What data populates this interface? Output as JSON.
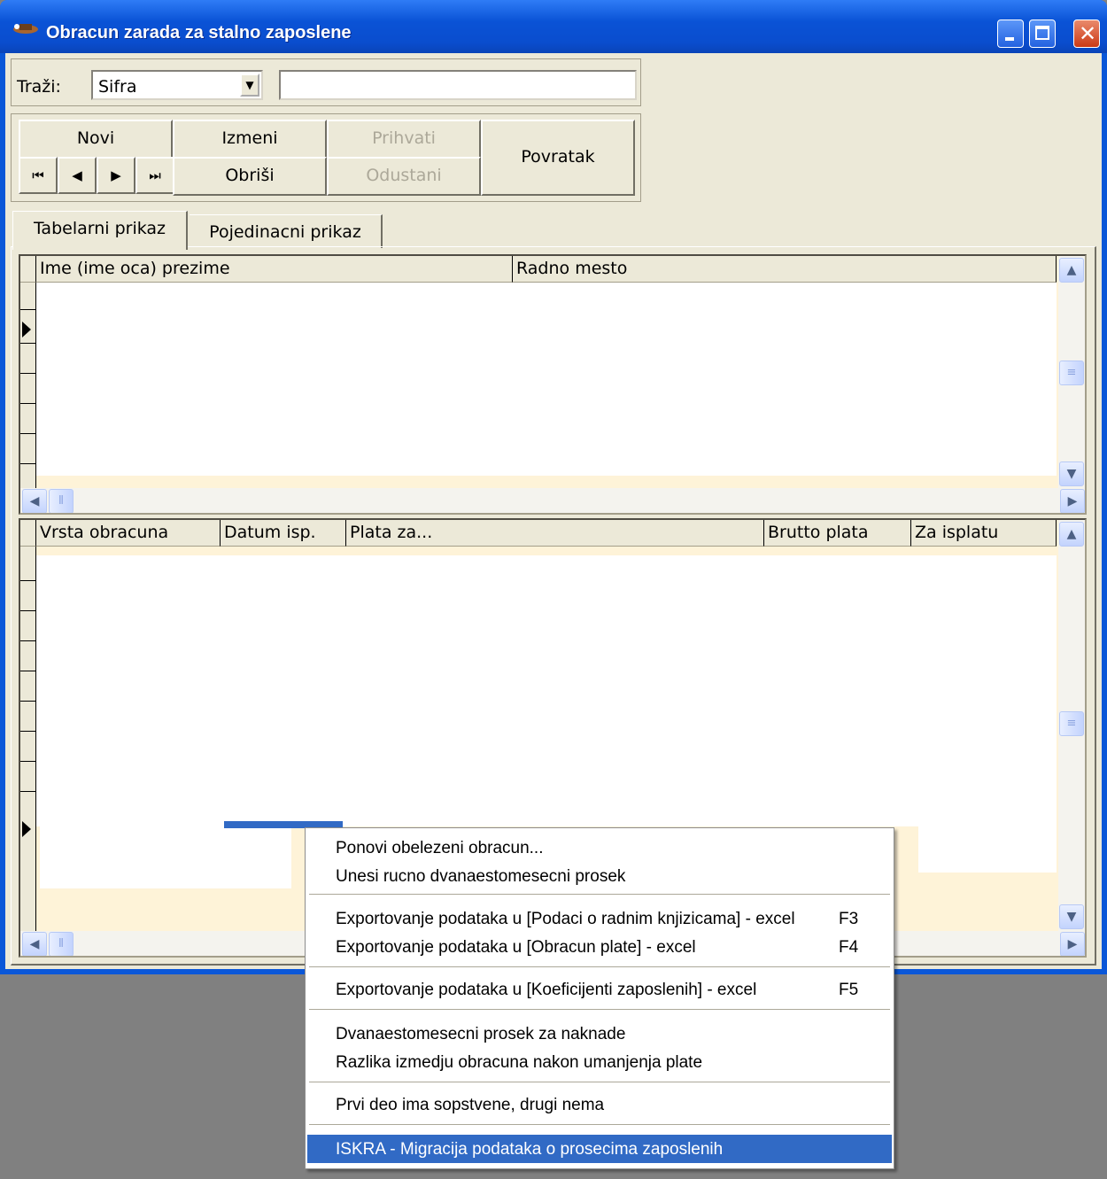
{
  "window": {
    "title": "Obracun zarada za stalno zaposlene"
  },
  "search": {
    "label": "Traži:",
    "field_value": "Sifra",
    "query_value": ""
  },
  "toolbar": {
    "new_label": "Novi",
    "edit_label": "Izmeni",
    "accept_label": "Prihvati",
    "delete_label": "Obriši",
    "cancel_label": "Odustani",
    "back_label": "Povratak",
    "nav": {
      "first": "⏮",
      "prev": "◀",
      "next": "▶",
      "last": "⏭"
    }
  },
  "tabs": [
    {
      "label": "Tabelarni prikaz",
      "active": true
    },
    {
      "label": "Pojedinacni prikaz",
      "active": false
    }
  ],
  "employees_grid": {
    "columns": [
      "Ime (ime oca) prezime",
      "Radno mesto"
    ],
    "rows": []
  },
  "payroll_grid": {
    "columns": [
      "Vrsta obracuna",
      "Datum isp.",
      "Plata za...",
      "Brutto plata",
      "Za isplatu"
    ],
    "rows": []
  },
  "context_menu": {
    "items": [
      {
        "label": "Ponovi obelezeni obracun...",
        "shortcut": ""
      },
      {
        "label": "Unesi rucno dvanaestomesecni prosek",
        "shortcut": ""
      },
      {
        "label": "Exportovanje podataka u [Podaci o radnim knjizicama] - excel",
        "shortcut": "F3"
      },
      {
        "label": "Exportovanje podataka u [Obracun plate] - excel",
        "shortcut": "F4"
      },
      {
        "label": "Exportovanje podataka u [Koeficijenti zaposlenih] - excel",
        "shortcut": "F5"
      },
      {
        "label": "Dvanaestomesecni prosek za naknade",
        "shortcut": ""
      },
      {
        "label": "Razlika izmedju obracuna nakon umanjenja plate",
        "shortcut": ""
      },
      {
        "label": "Prvi deo ima sopstvene, drugi nema",
        "shortcut": ""
      },
      {
        "label": "ISKRA - Migracija podataka o prosecima zaposlenih",
        "shortcut": "",
        "highlighted": true
      }
    ]
  },
  "colors": {
    "title_bar": "#0a53d6",
    "menu_highlight": "#316ac5",
    "grid_bg": "#fef3d8",
    "dialog_bg": "#ece9d8"
  }
}
